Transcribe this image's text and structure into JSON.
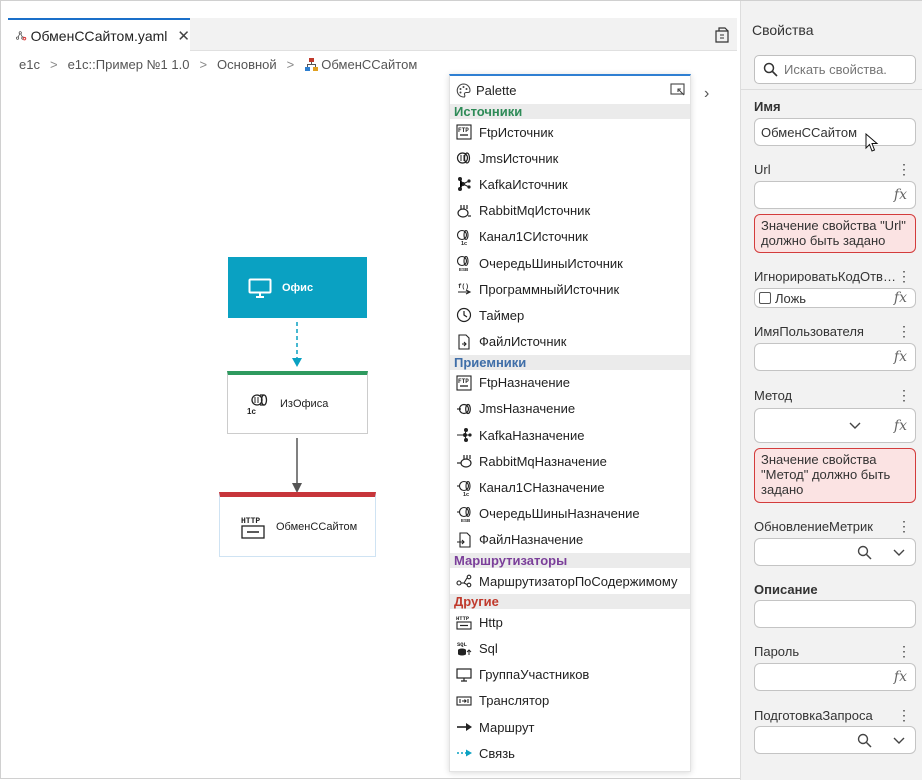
{
  "editor": {
    "tab_label": "ОбменССайтом.yaml",
    "tab_close": "✕"
  },
  "breadcrumb": [
    "e1c",
    "e1c::Пример №1 1.0",
    "Основной",
    "ОбменССайтом"
  ],
  "canvas": {
    "node_office": "Офис",
    "node_in": "ИзОфиса",
    "node_out": "ОбменССайтом"
  },
  "palette": {
    "title": "Palette",
    "categories": [
      {
        "name": "Источники",
        "color": "#2e8b57",
        "items": [
          {
            "label": "FtpИсточник",
            "icon": "ftp-icon"
          },
          {
            "label": "JmsИсточник",
            "icon": "jms-icon"
          },
          {
            "label": "KafkaИсточник",
            "icon": "kafka-icon"
          },
          {
            "label": "RabbitMqИсточник",
            "icon": "rabbitmq-icon"
          },
          {
            "label": "Канал1СИсточник",
            "icon": "channel-1c-icon"
          },
          {
            "label": "ОчередьШиныИсточник",
            "icon": "esb-queue-icon"
          },
          {
            "label": "ПрограммныйИсточник",
            "icon": "program-source-icon"
          },
          {
            "label": "Таймер",
            "icon": "timer-icon"
          },
          {
            "label": "ФайлИсточник",
            "icon": "file-icon"
          }
        ]
      },
      {
        "name": "Приемники",
        "color": "#3f6ea8",
        "items": [
          {
            "label": "FtpНазначение",
            "icon": "ftp-icon"
          },
          {
            "label": "JmsНазначение",
            "icon": "jms-icon"
          },
          {
            "label": "KafkaНазначение",
            "icon": "kafka-icon"
          },
          {
            "label": "RabbitMqНазначение",
            "icon": "rabbitmq-icon"
          },
          {
            "label": "Канал1СНазначение",
            "icon": "channel-1c-icon"
          },
          {
            "label": "ОчередьШиныНазначение",
            "icon": "esb-queue-icon"
          },
          {
            "label": "ФайлНазначение",
            "icon": "file-icon"
          }
        ]
      },
      {
        "name": "Маршрутизаторы",
        "color": "#7b3f9a",
        "items": [
          {
            "label": "МаршрутизаторПоСодержимому",
            "icon": "router-icon"
          }
        ]
      },
      {
        "name": "Другие",
        "color": "#c0392b",
        "items": [
          {
            "label": "Http",
            "icon": "http-icon"
          },
          {
            "label": "Sql",
            "icon": "sql-icon"
          },
          {
            "label": "ГруппаУчастников",
            "icon": "monitor-icon"
          },
          {
            "label": "Транслятор",
            "icon": "translator-icon"
          },
          {
            "label": "Маршрут",
            "icon": "route-arrow-icon"
          },
          {
            "label": "Связь",
            "icon": "link-arrow-icon"
          }
        ]
      }
    ]
  },
  "properties": {
    "title": "Свойства",
    "search_placeholder": "Искать свойства.",
    "name_label": "Имя",
    "name_value": "ОбменССайтом",
    "url_label": "Url",
    "url_error": "Значение свойства \"Url\" должно быть задано",
    "ignore_label": "ИгнорироватьКодОтв…",
    "ignore_value": "Ложь",
    "username_label": "ИмяПользователя",
    "method_label": "Метод",
    "method_error": "Значение свойства \"Метод\" должно быть задано",
    "metrics_label": "ОбновлениеМетрик",
    "description_label": "Описание",
    "password_label": "Пароль",
    "prep_label": "ПодготовкаЗапроса",
    "fx": "fx"
  },
  "colors": {
    "accent": "#1a6fc9",
    "office_node": "#0aa1c2",
    "in_node_bar": "#2e9a5f",
    "out_node_bar": "#c7353b",
    "error_bg": "#fbe3e3",
    "error_border": "#d33c3c"
  }
}
